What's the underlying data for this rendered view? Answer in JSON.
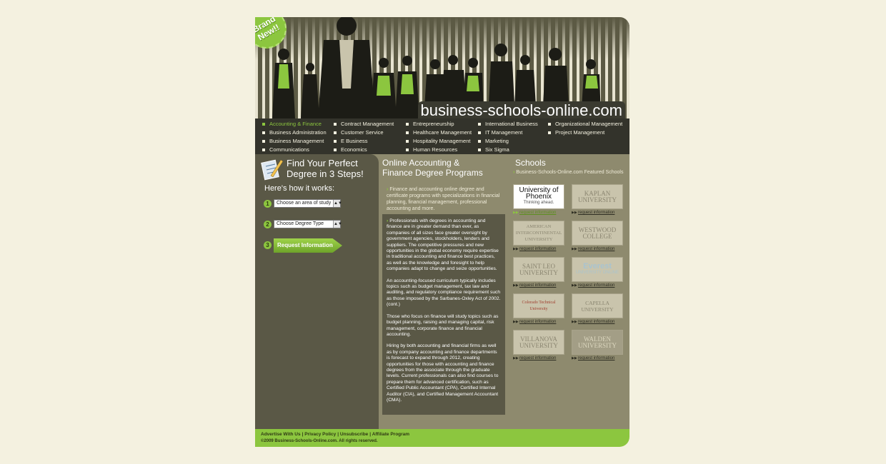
{
  "header": {
    "badge_line1": "Brand",
    "badge_line2": "New!!",
    "site_title": "business-schools-online.com"
  },
  "nav": {
    "columns": [
      [
        "Accounting & Finance",
        "Business Administration",
        "Business Management",
        "Communications"
      ],
      [
        "Contract Management",
        "Customer Service",
        "E Business",
        "Economics"
      ],
      [
        "Entrepreneurship",
        "Healthcare Management",
        "Hospitality Management",
        "Human Resources"
      ],
      [
        "International Business",
        "IT Management",
        "Marketing",
        "Six Sigma"
      ],
      [
        "Organizational Management",
        "Project Management"
      ]
    ],
    "active": "Accounting & Finance"
  },
  "steps": {
    "title_line1": "Find Your Perfect",
    "title_line2": "Degree in 3 Steps!",
    "hows": "Here's how it works:",
    "step1_num": "1",
    "step1_select": "Choose an area of study",
    "step2_num": "2",
    "step2_select": "Choose Degree Type",
    "step3_num": "3",
    "step3_button": "Request Information"
  },
  "main": {
    "title_line1": "Online Accounting &",
    "title_line2": "Finance Degree Programs",
    "intro": "Finance and accounting online degree and certificate programs with specializations in financial planning, financial management, professional accounting and more.",
    "paragraphs": [
      "Professionals with degrees in accounting and finance are in greater demand than ever, as companies of all sizes face greater oversight by government agencies, stockholders, lenders and suppliers. The competitive pressures and new opportunities in the global economy require expertise in traditional accounting and finance best practices, as well as the knowledge and foresight to help companies adapt to change and seize opportunities.",
      "An accounting-focused curriculum typically includes topics such as budget management, tax law and auditing, and regulatory compliance requirement such as those imposed by the Sarbanes-Oxley Act of 2002. (cont.)",
      "Those who focus on finance will study topics such as budget planning, raising and managing capital, risk management, corporate finance and financial accounting.",
      "Hiring by both accounting and financial firms as well as by company accounting and finance departments is forecast to expand through 2012, creating opportunities for those with accounting and finance degrees from the associate through the graduate levels. Current professionals can also find courses to prepare them for advanced certification, such as Certified Public Accountant (CPA), Certified Internal Auditor (CIA), and Certified Management Accountant (CMA)."
    ]
  },
  "schools": {
    "title": "Schools",
    "subtitle": "Business-Schools-Online.com Featured Schools",
    "link_label": "request information",
    "items": [
      {
        "name": "University of Phoenix",
        "tagline": "Thinking ahead."
      },
      {
        "name": "KAPLAN UNIVERSITY",
        "tagline": ""
      },
      {
        "name": "AMERICAN INTERCONTINENTAL UNIVERSITY",
        "tagline": ""
      },
      {
        "name": "WESTWOOD COLLEGE",
        "tagline": ""
      },
      {
        "name": "SAINT LEO UNIVERSITY",
        "tagline": ""
      },
      {
        "name": "Everest",
        "tagline": "UNIVERSITY ONLINE"
      },
      {
        "name": "Colorado Technical University",
        "tagline": ""
      },
      {
        "name": "CAPELLA UNIVERSITY",
        "tagline": ""
      },
      {
        "name": "VILLANOVA UNIVERSITY",
        "tagline": ""
      },
      {
        "name": "WALDEN UNIVERSITY",
        "tagline": ""
      }
    ]
  },
  "footer": {
    "links": [
      "Advertise With Us",
      "Privacy Policy",
      "Unsubscribe",
      "Affiliate Program"
    ],
    "copyright": "©2009 Business-Schools-Online.com. All rights reserved."
  },
  "colors": {
    "accent_green": "#8cc63f",
    "dark": "#33332b",
    "olive": "#8e8a6e",
    "panel": "#5a5846",
    "page_bg": "#f4f1e0"
  }
}
